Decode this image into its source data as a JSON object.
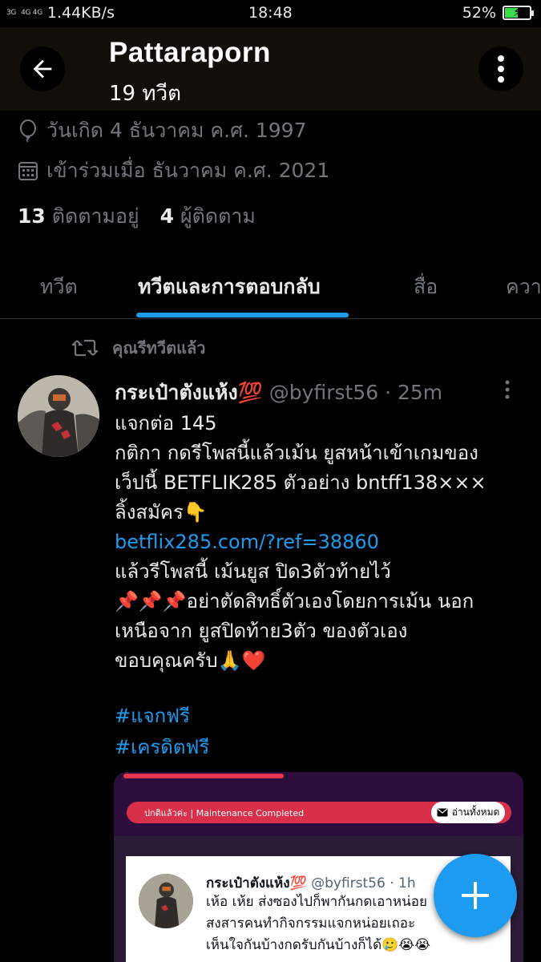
{
  "status_bar": {
    "network_left": "3G",
    "network_mid": "4G 4G",
    "speed": "1.44KB/s",
    "time": "18:48",
    "battery_percent": "52%",
    "battery_level": 0.52
  },
  "header": {
    "title": "Pattaraporn",
    "subtitle": "19 ทวีต",
    "back_icon": "arrow-left-icon",
    "more_icon": "more-vertical-icon"
  },
  "profile": {
    "birthday": "วันเกิด 4 ธันวาคม ค.ศ. 1997",
    "joined": "เข้าร่วมเมื่อ ธันวาคม ค.ศ. 2021",
    "following_count": "13",
    "following_label": "ติดตามอยู่",
    "followers_count": "4",
    "followers_label": "ผู้ติดตาม"
  },
  "tabs": [
    {
      "label": "ทวีต",
      "active": false
    },
    {
      "label": "ทวีตและการตอบกลับ",
      "active": true
    },
    {
      "label": "สื่อ",
      "active": false
    },
    {
      "label": "ควา",
      "active": false
    }
  ],
  "tweet": {
    "retweet_label": "คุณรีทวีตแล้ว",
    "display_name": "กระเป๋าตังแห้ง💯",
    "handle": "@byfirst56",
    "time": "· 25m",
    "lines": [
      "แจกต่อ 145",
      "กติกา กดรีโพสนี้แล้วเม้น ยูสหน้าเข้าเกมของ",
      "เว็ปนี้ BETFLIK285 ตัวอย่าง bntff138×××",
      "ลิ้งสมัคร👇"
    ],
    "link": "betflix285.com/?ref=38860",
    "lines_after": [
      "แล้วรีโพสนี้ เม้นยูส ปิด3ตัวท้ายไว้",
      "📌📌📌อย่าตัดสิทธิ์ตัวเองโดยการเม้น นอก",
      "เหนือจาก ยูสปิดท้าย3ตัว ของตัวเอง",
      "ขอบคุณครับ🙏❤️"
    ],
    "hashtags": [
      "#แจกฟรี",
      "#เครดิตฟรี"
    ]
  },
  "media": {
    "banner_text": "ปกติแล้วค่ะ | Maintenance Completed",
    "pill_text": "อ่านทั้งหมด",
    "embedded": {
      "display_name": "กระเป๋าตังแห้ง💯",
      "handle": "@byfirst56 · 1h",
      "lines": [
        "เห้อ เห้ย ส่งซองไปก็พากันกดเอาหน่อย",
        "สงสารคนทำกิจกรรมแจกหน่อยเถอะ",
        "เห็นใจกันบ้างกดรับกันบ้างก็ได้🥲😭😭"
      ]
    }
  },
  "colors": {
    "accent": "#1d9bf0",
    "background": "#000000",
    "header_bg": "#120f0a",
    "muted_text": "#71767b"
  },
  "fab": {
    "icon": "plus-icon"
  }
}
